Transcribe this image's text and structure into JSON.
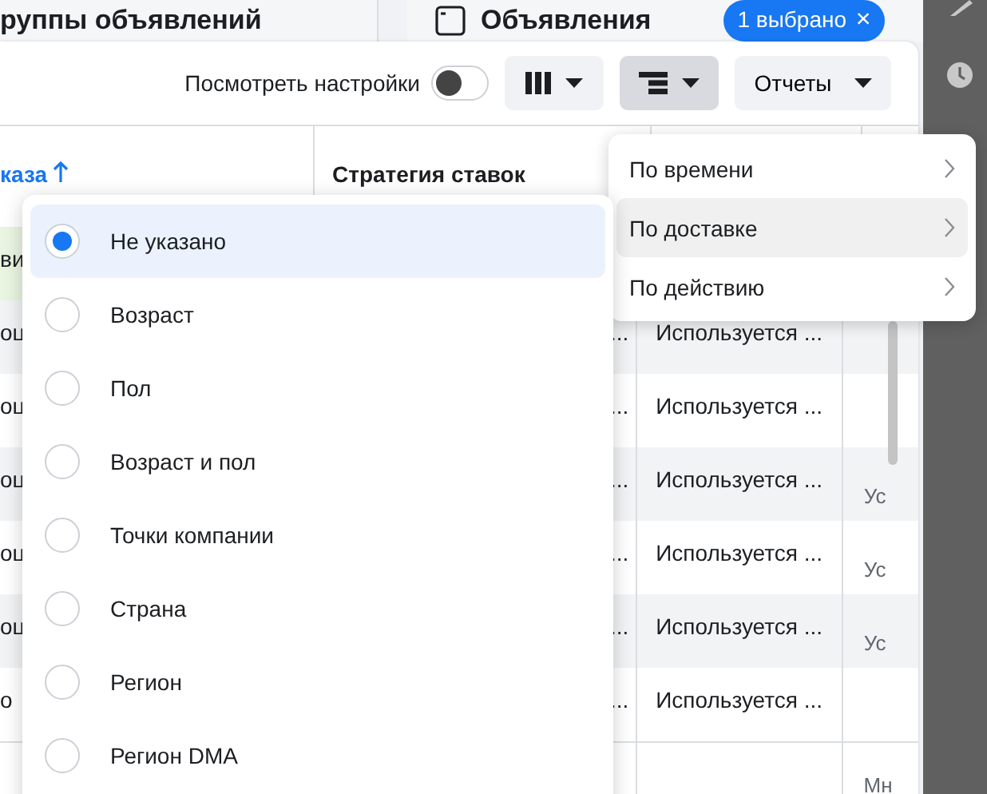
{
  "header": {
    "section_title": "руппы объявлений",
    "ads_title": "Объявления",
    "selection_badge": "1 выбрано",
    "badge_close": "×"
  },
  "toolbar": {
    "settings_label": "Посмотреть настройки",
    "settings_toggle_on": false,
    "buttons": [
      {
        "kind": "columns",
        "active": false
      },
      {
        "kind": "breakdown",
        "active": true
      },
      {
        "kind": "text",
        "label": "Отчеты",
        "active": false
      }
    ]
  },
  "table": {
    "columns": [
      {
        "label": "каза",
        "sorted": true
      },
      {
        "label": "Стратегия ставок"
      }
    ],
    "rows": [
      {
        "column_1": "ви",
        "highlighted": true
      },
      {
        "column_1": "оц",
        "column_2": "...",
        "column_3": "Используется ...",
        "highlighted": false
      },
      {
        "column_1": "оц",
        "column_2": "...",
        "column_3": "Используется ...",
        "highlighted": false
      },
      {
        "column_1": "оц",
        "column_2": "...",
        "column_3": "Используется ...",
        "column_4": "Ус",
        "highlighted": false
      },
      {
        "column_1": "оц",
        "column_2": "...",
        "column_3": "Используется ...",
        "column_4": "Ус",
        "highlighted": false
      },
      {
        "column_1": "оц",
        "column_2": "...",
        "column_3": "Используется ...",
        "column_4": "Ус",
        "highlighted": false
      },
      {
        "column_1": "о",
        "column_2": "...",
        "column_3": "Используется ...",
        "highlighted": false
      }
    ],
    "footer_column_4": "Мн"
  },
  "breakdown_menu": {
    "items": [
      {
        "label": "По времени",
        "selected": false
      },
      {
        "label": "По доставке",
        "selected": true
      },
      {
        "label": "По действию",
        "selected": false
      }
    ]
  },
  "breakdown_submenu": {
    "items": [
      {
        "label": "Не указано",
        "selected": true
      },
      {
        "label": "Возраст",
        "selected": false
      },
      {
        "label": "Пол",
        "selected": false
      },
      {
        "label": "Возраст и пол",
        "selected": false
      },
      {
        "label": "Точки компании",
        "selected": false
      },
      {
        "label": "Страна",
        "selected": false
      },
      {
        "label": "Регион",
        "selected": false
      },
      {
        "label": "Регион DMA",
        "selected": false
      }
    ]
  }
}
